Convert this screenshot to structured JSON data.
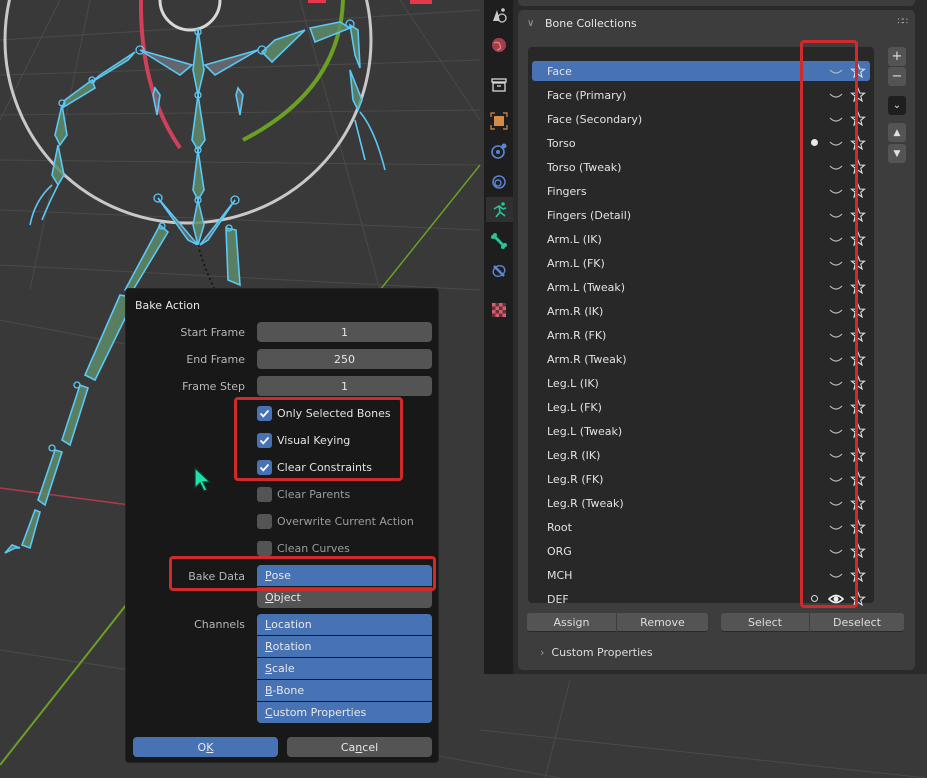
{
  "viewport": {
    "cursor_icon": "mouse-pointer-icon"
  },
  "properties": {
    "tabs": [
      {
        "name": "scene-tab",
        "icon": "scene-icon"
      },
      {
        "name": "world-tab",
        "icon": "world-icon"
      },
      {
        "name": "collection-tab",
        "icon": "collection-icon"
      },
      {
        "name": "object-tab",
        "icon": "object-icon"
      },
      {
        "name": "physics-tab",
        "icon": "physics-icon"
      },
      {
        "name": "constraints-tab",
        "icon": "object-constraint-icon"
      },
      {
        "name": "object-data-armature-tab",
        "icon": "armature-icon",
        "active": true
      },
      {
        "name": "bone-tab",
        "icon": "bone-icon"
      },
      {
        "name": "bone-constraint-tab",
        "icon": "bone-constraint-icon"
      },
      {
        "name": "texture-tab",
        "icon": "texture-icon"
      }
    ],
    "bone_collections": {
      "title": "Bone Collections",
      "items": [
        {
          "name": "Face",
          "selected": true,
          "dot": "",
          "visible": false
        },
        {
          "name": "Face (Primary)",
          "dot": "",
          "visible": false
        },
        {
          "name": "Face (Secondary)",
          "dot": "",
          "visible": false
        },
        {
          "name": "Torso",
          "dot": "filled",
          "visible": false
        },
        {
          "name": "Torso (Tweak)",
          "dot": "",
          "visible": false
        },
        {
          "name": "Fingers",
          "dot": "",
          "visible": false
        },
        {
          "name": "Fingers (Detail)",
          "dot": "",
          "visible": false
        },
        {
          "name": "Arm.L (IK)",
          "dot": "",
          "visible": false
        },
        {
          "name": "Arm.L (FK)",
          "dot": "",
          "visible": false
        },
        {
          "name": "Arm.L (Tweak)",
          "dot": "",
          "visible": false
        },
        {
          "name": "Arm.R (IK)",
          "dot": "",
          "visible": false
        },
        {
          "name": "Arm.R (FK)",
          "dot": "",
          "visible": false
        },
        {
          "name": "Arm.R (Tweak)",
          "dot": "",
          "visible": false
        },
        {
          "name": "Leg.L (IK)",
          "dot": "",
          "visible": false
        },
        {
          "name": "Leg.L (FK)",
          "dot": "",
          "visible": false
        },
        {
          "name": "Leg.L (Tweak)",
          "dot": "",
          "visible": false
        },
        {
          "name": "Leg.R (IK)",
          "dot": "",
          "visible": false
        },
        {
          "name": "Leg.R (FK)",
          "dot": "",
          "visible": false
        },
        {
          "name": "Leg.R (Tweak)",
          "dot": "",
          "visible": false
        },
        {
          "name": "Root",
          "dot": "",
          "visible": false
        },
        {
          "name": "ORG",
          "dot": "",
          "visible": false
        },
        {
          "name": "MCH",
          "dot": "",
          "visible": false
        },
        {
          "name": "DEF",
          "dot": "hollow",
          "visible": true
        }
      ],
      "side_buttons": {
        "add": "+",
        "remove": "−",
        "specials": "⌄",
        "move_up": "▲",
        "move_down": "▼"
      },
      "assign_label": "Assign",
      "remove_label": "Remove",
      "select_label": "Select",
      "deselect_label": "Deselect"
    },
    "custom_properties": {
      "title": "Custom Properties"
    }
  },
  "bake_action": {
    "title": "Bake Action",
    "start_frame": {
      "label": "Start Frame",
      "value": "1"
    },
    "end_frame": {
      "label": "End Frame",
      "value": "250"
    },
    "frame_step": {
      "label": "Frame Step",
      "value": "1"
    },
    "options": [
      {
        "label": "Only Selected Bones",
        "checked": true
      },
      {
        "label": "Visual Keying",
        "checked": true
      },
      {
        "label": "Clear Constraints",
        "checked": true
      },
      {
        "label": "Clear Parents",
        "checked": false
      },
      {
        "label": "Overwrite Current Action",
        "checked": false
      },
      {
        "label": "Clean Curves",
        "checked": false
      }
    ],
    "bake_data": {
      "label": "Bake Data",
      "options": [
        {
          "key": "P",
          "rest": "ose",
          "selected": true
        },
        {
          "key": "O",
          "rest": "bject",
          "selected": false
        }
      ]
    },
    "channels": {
      "label": "Channels",
      "options": [
        {
          "key": "L",
          "rest": "ocation",
          "selected": true
        },
        {
          "key": "R",
          "rest": "otation",
          "selected": true
        },
        {
          "key": "S",
          "rest": "cale",
          "selected": true
        },
        {
          "key": "B",
          "rest": "-Bone",
          "selected": true
        },
        {
          "key": "C",
          "rest": "ustom Properties",
          "selected": true
        }
      ]
    },
    "ok": {
      "pre": "O",
      "key": "K",
      "post": ""
    },
    "cancel": {
      "pre": "Ca",
      "key": "n",
      "post": "cel"
    }
  },
  "colors": {
    "accent": "#4772b3",
    "highlight_red": "#d02a2a",
    "bone_outline": "#5bc8f5",
    "bone_fill": "#5a8a6a",
    "x_axis": "#d0405a",
    "y_axis": "#6aa024"
  }
}
